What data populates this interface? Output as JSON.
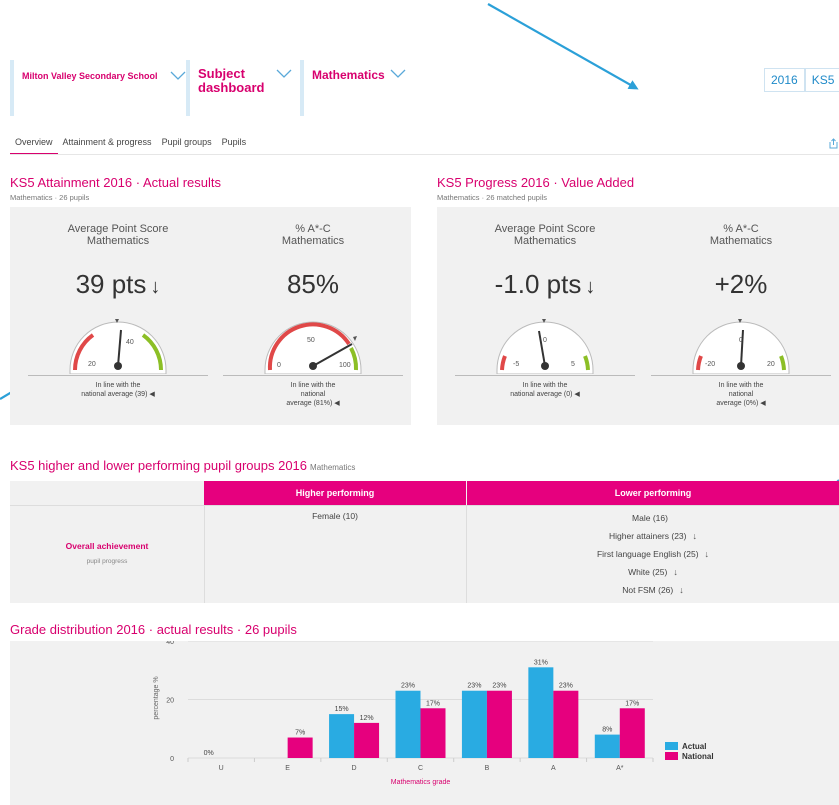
{
  "header": {
    "school": "Milton Valley Secondary School",
    "dashboard_line1": "Subject",
    "dashboard_line2": "dashboard",
    "subject": "Mathematics",
    "year": "2016",
    "stage": "KS5"
  },
  "tabs": [
    {
      "label": "Overview",
      "active": true
    },
    {
      "label": "Attainment & progress",
      "active": false
    },
    {
      "label": "Pupil groups",
      "active": false
    },
    {
      "label": "Pupils",
      "active": false
    }
  ],
  "attainment": {
    "title": "KS5 Attainment 2016 · Actual results",
    "subtitle": "Mathematics · 26 pupils",
    "gauges": [
      {
        "title1": "Average Point Score",
        "title2": "Mathematics",
        "value": "39 pts",
        "trend": "↓",
        "labels": [
          "20",
          "40"
        ],
        "note1": "In line with the",
        "note2": "national average (39)",
        "note3": "",
        "marker": "◀"
      },
      {
        "title1": "% A*-C",
        "title2": "Mathematics",
        "value": "85%",
        "trend": "",
        "labels": [
          "0",
          "50",
          "100"
        ],
        "note1": "In line with the",
        "note2": "national",
        "note3": "average (81%)",
        "marker": "◀"
      }
    ]
  },
  "progress": {
    "title": "KS5 Progress 2016 · Value Added",
    "subtitle": "Mathematics · 26 matched pupils",
    "gauges": [
      {
        "title1": "Average Point Score",
        "title2": "Mathematics",
        "value": "-1.0 pts",
        "trend": "↓",
        "labels": [
          "-5",
          "0",
          "5"
        ],
        "note1": "In line with the",
        "note2": "national average (0)",
        "note3": "",
        "marker": "◀"
      },
      {
        "title1": "% A*-C",
        "title2": "Mathematics",
        "value": "+2%",
        "trend": "",
        "labels": [
          "-20",
          "0",
          "20"
        ],
        "note1": "In line with the",
        "note2": "national",
        "note3": "average (0%)",
        "marker": "◀"
      }
    ]
  },
  "pupil_groups": {
    "title": "KS5 higher and lower performing pupil groups 2016",
    "subject": "Mathematics",
    "higher_header": "Higher performing",
    "lower_header": "Lower performing",
    "row_label": "Overall achievement",
    "row_sub": "pupil progress",
    "higher": [
      "Female (10)"
    ],
    "lower": [
      {
        "label": "Male (16)",
        "arrow": ""
      },
      {
        "label": "Higher attainers (23)",
        "arrow": "↓"
      },
      {
        "label": "First language English (25)",
        "arrow": "↓"
      },
      {
        "label": "White (25)",
        "arrow": "↓"
      },
      {
        "label": "Not FSM (26)",
        "arrow": "↓"
      }
    ]
  },
  "grade_title": "Grade distribution 2016 · actual results · 26 pupils",
  "colors": {
    "accent": "#d8006e",
    "actual": "#29abe2",
    "national": "#e6007e",
    "arrow": "#2ba0d8"
  },
  "chart_data": {
    "type": "bar",
    "categories": [
      "U",
      "E",
      "D",
      "C",
      "B",
      "A",
      "A*"
    ],
    "series": [
      {
        "name": "Actual",
        "values": [
          0,
          null,
          15,
          23,
          23,
          31,
          8
        ]
      },
      {
        "name": "National",
        "values": [
          null,
          7,
          12,
          17,
          23,
          23,
          17
        ]
      }
    ],
    "data_labels": {
      "Actual": [
        "0%",
        "",
        "15%",
        "23%",
        "23%",
        "31%",
        "8%"
      ],
      "National": [
        "",
        "7%",
        "12%",
        "17%",
        "23%",
        "23%",
        "17%"
      ]
    },
    "xlabel": "Mathematics grade",
    "ylabel": "percentage %",
    "ylim": [
      0,
      40
    ],
    "yticks": [
      "0",
      "20",
      "40"
    ],
    "legend": "right"
  }
}
